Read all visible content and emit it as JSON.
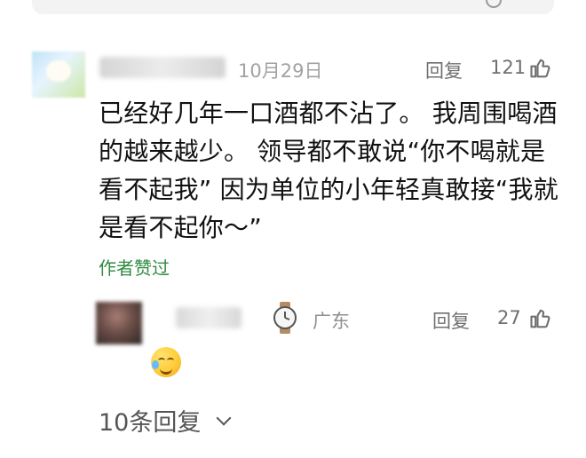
{
  "comment": {
    "date": "10月29日",
    "reply_label": "回复",
    "likes": "121",
    "text": "已经好几年一口酒都不沾了。 我周围喝酒的越来越少。 领导都不敢说“你不喝就是看不起我” 因为单位的小年轻真敢接“我就是看不起你～”",
    "author_liked": "作者赞过"
  },
  "reply": {
    "location": "广东",
    "reply_label": "回复",
    "likes": "27"
  },
  "more_replies": "10条回复",
  "icons": {
    "like": "thumbs-up-icon",
    "watch": "watch-icon",
    "emoji": "laughing-crying-emoji-icon",
    "chevron": "chevron-down-icon"
  },
  "colors": {
    "green": "#2f8a41",
    "meta_gray": "#a2a2a2",
    "action_gray": "#707070"
  }
}
